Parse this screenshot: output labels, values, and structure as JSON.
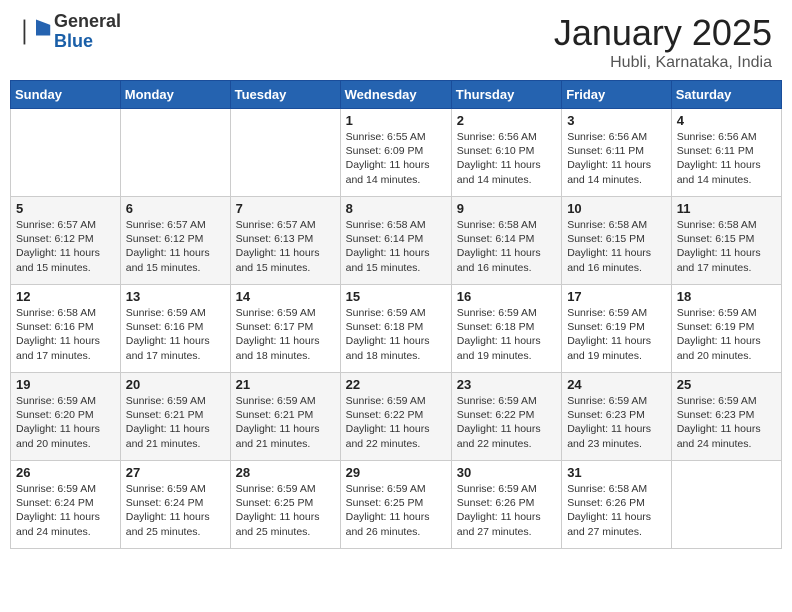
{
  "header": {
    "logo_general": "General",
    "logo_blue": "Blue",
    "title": "January 2025",
    "subtitle": "Hubli, Karnataka, India"
  },
  "days_of_week": [
    "Sunday",
    "Monday",
    "Tuesday",
    "Wednesday",
    "Thursday",
    "Friday",
    "Saturday"
  ],
  "weeks": [
    [
      {
        "day": "",
        "info": ""
      },
      {
        "day": "",
        "info": ""
      },
      {
        "day": "",
        "info": ""
      },
      {
        "day": "1",
        "info": "Sunrise: 6:55 AM\nSunset: 6:09 PM\nDaylight: 11 hours and 14 minutes."
      },
      {
        "day": "2",
        "info": "Sunrise: 6:56 AM\nSunset: 6:10 PM\nDaylight: 11 hours and 14 minutes."
      },
      {
        "day": "3",
        "info": "Sunrise: 6:56 AM\nSunset: 6:11 PM\nDaylight: 11 hours and 14 minutes."
      },
      {
        "day": "4",
        "info": "Sunrise: 6:56 AM\nSunset: 6:11 PM\nDaylight: 11 hours and 14 minutes."
      }
    ],
    [
      {
        "day": "5",
        "info": "Sunrise: 6:57 AM\nSunset: 6:12 PM\nDaylight: 11 hours and 15 minutes."
      },
      {
        "day": "6",
        "info": "Sunrise: 6:57 AM\nSunset: 6:12 PM\nDaylight: 11 hours and 15 minutes."
      },
      {
        "day": "7",
        "info": "Sunrise: 6:57 AM\nSunset: 6:13 PM\nDaylight: 11 hours and 15 minutes."
      },
      {
        "day": "8",
        "info": "Sunrise: 6:58 AM\nSunset: 6:14 PM\nDaylight: 11 hours and 15 minutes."
      },
      {
        "day": "9",
        "info": "Sunrise: 6:58 AM\nSunset: 6:14 PM\nDaylight: 11 hours and 16 minutes."
      },
      {
        "day": "10",
        "info": "Sunrise: 6:58 AM\nSunset: 6:15 PM\nDaylight: 11 hours and 16 minutes."
      },
      {
        "day": "11",
        "info": "Sunrise: 6:58 AM\nSunset: 6:15 PM\nDaylight: 11 hours and 17 minutes."
      }
    ],
    [
      {
        "day": "12",
        "info": "Sunrise: 6:58 AM\nSunset: 6:16 PM\nDaylight: 11 hours and 17 minutes."
      },
      {
        "day": "13",
        "info": "Sunrise: 6:59 AM\nSunset: 6:16 PM\nDaylight: 11 hours and 17 minutes."
      },
      {
        "day": "14",
        "info": "Sunrise: 6:59 AM\nSunset: 6:17 PM\nDaylight: 11 hours and 18 minutes."
      },
      {
        "day": "15",
        "info": "Sunrise: 6:59 AM\nSunset: 6:18 PM\nDaylight: 11 hours and 18 minutes."
      },
      {
        "day": "16",
        "info": "Sunrise: 6:59 AM\nSunset: 6:18 PM\nDaylight: 11 hours and 19 minutes."
      },
      {
        "day": "17",
        "info": "Sunrise: 6:59 AM\nSunset: 6:19 PM\nDaylight: 11 hours and 19 minutes."
      },
      {
        "day": "18",
        "info": "Sunrise: 6:59 AM\nSunset: 6:19 PM\nDaylight: 11 hours and 20 minutes."
      }
    ],
    [
      {
        "day": "19",
        "info": "Sunrise: 6:59 AM\nSunset: 6:20 PM\nDaylight: 11 hours and 20 minutes."
      },
      {
        "day": "20",
        "info": "Sunrise: 6:59 AM\nSunset: 6:21 PM\nDaylight: 11 hours and 21 minutes."
      },
      {
        "day": "21",
        "info": "Sunrise: 6:59 AM\nSunset: 6:21 PM\nDaylight: 11 hours and 21 minutes."
      },
      {
        "day": "22",
        "info": "Sunrise: 6:59 AM\nSunset: 6:22 PM\nDaylight: 11 hours and 22 minutes."
      },
      {
        "day": "23",
        "info": "Sunrise: 6:59 AM\nSunset: 6:22 PM\nDaylight: 11 hours and 22 minutes."
      },
      {
        "day": "24",
        "info": "Sunrise: 6:59 AM\nSunset: 6:23 PM\nDaylight: 11 hours and 23 minutes."
      },
      {
        "day": "25",
        "info": "Sunrise: 6:59 AM\nSunset: 6:23 PM\nDaylight: 11 hours and 24 minutes."
      }
    ],
    [
      {
        "day": "26",
        "info": "Sunrise: 6:59 AM\nSunset: 6:24 PM\nDaylight: 11 hours and 24 minutes."
      },
      {
        "day": "27",
        "info": "Sunrise: 6:59 AM\nSunset: 6:24 PM\nDaylight: 11 hours and 25 minutes."
      },
      {
        "day": "28",
        "info": "Sunrise: 6:59 AM\nSunset: 6:25 PM\nDaylight: 11 hours and 25 minutes."
      },
      {
        "day": "29",
        "info": "Sunrise: 6:59 AM\nSunset: 6:25 PM\nDaylight: 11 hours and 26 minutes."
      },
      {
        "day": "30",
        "info": "Sunrise: 6:59 AM\nSunset: 6:26 PM\nDaylight: 11 hours and 27 minutes."
      },
      {
        "day": "31",
        "info": "Sunrise: 6:58 AM\nSunset: 6:26 PM\nDaylight: 11 hours and 27 minutes."
      },
      {
        "day": "",
        "info": ""
      }
    ]
  ]
}
